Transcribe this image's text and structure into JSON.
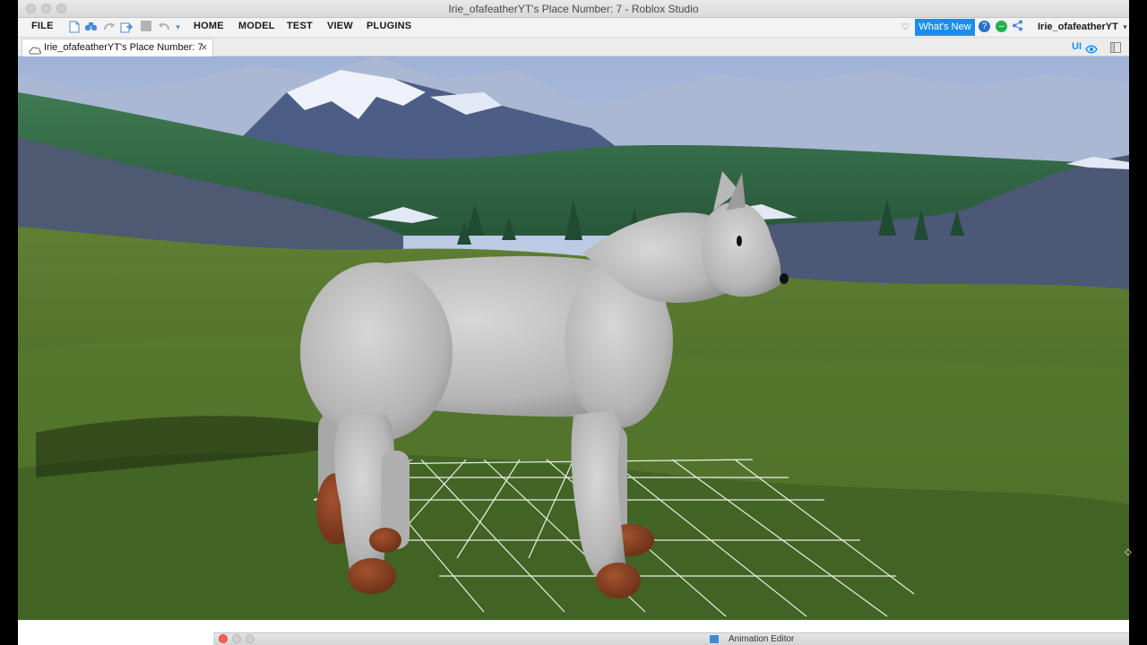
{
  "window": {
    "title": "Irie_ofafeatherYT's Place Number: 7 - Roblox Studio"
  },
  "menubar": {
    "file": "FILE",
    "home": "HOME",
    "model": "MODEL",
    "test": "TEST",
    "view": "VIEW",
    "plugins": "PLUGINS",
    "whats_new": "What's New",
    "username": "Irie_ofafeatherYT",
    "quick_access": [
      "new-file-icon",
      "binoculars-icon",
      "redo-icon",
      "publish-icon",
      "stop-icon",
      "undo-icon",
      "dropdown-icon"
    ]
  },
  "tabs": {
    "document_tab": "Irie_ofafeatherYT's Place Number: 7",
    "close_symbol": "×",
    "ui_toggle": "UI"
  },
  "bottom": {
    "animation_editor": "Animation Editor"
  },
  "colors": {
    "accent": "#1a8ef0",
    "record_red": "#ff5f57",
    "status_green": "#22b14c",
    "help_blue": "#2a6fc9"
  }
}
